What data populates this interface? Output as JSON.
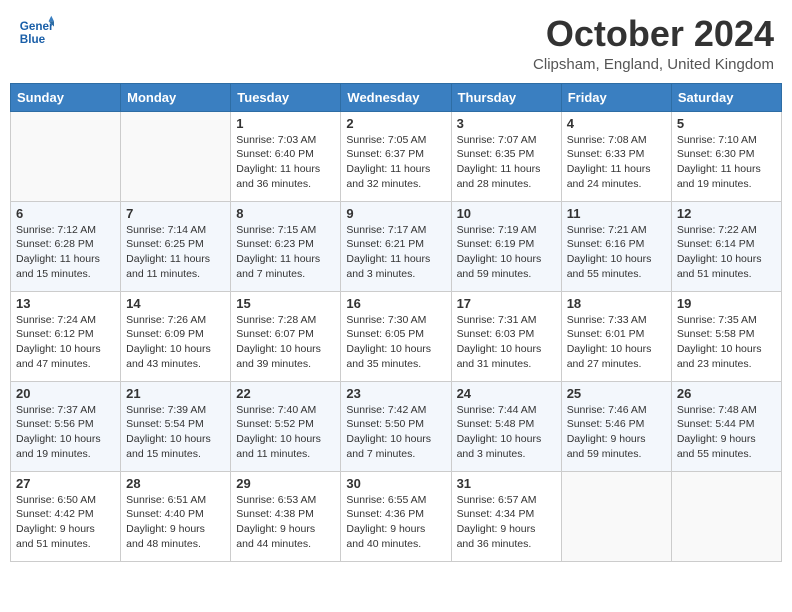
{
  "header": {
    "logo_line1": "General",
    "logo_line2": "Blue",
    "month_title": "October 2024",
    "location": "Clipsham, England, United Kingdom"
  },
  "days_of_week": [
    "Sunday",
    "Monday",
    "Tuesday",
    "Wednesday",
    "Thursday",
    "Friday",
    "Saturday"
  ],
  "weeks": [
    [
      {
        "day": "",
        "info": ""
      },
      {
        "day": "",
        "info": ""
      },
      {
        "day": "1",
        "info": "Sunrise: 7:03 AM\nSunset: 6:40 PM\nDaylight: 11 hours and 36 minutes."
      },
      {
        "day": "2",
        "info": "Sunrise: 7:05 AM\nSunset: 6:37 PM\nDaylight: 11 hours and 32 minutes."
      },
      {
        "day": "3",
        "info": "Sunrise: 7:07 AM\nSunset: 6:35 PM\nDaylight: 11 hours and 28 minutes."
      },
      {
        "day": "4",
        "info": "Sunrise: 7:08 AM\nSunset: 6:33 PM\nDaylight: 11 hours and 24 minutes."
      },
      {
        "day": "5",
        "info": "Sunrise: 7:10 AM\nSunset: 6:30 PM\nDaylight: 11 hours and 19 minutes."
      }
    ],
    [
      {
        "day": "6",
        "info": "Sunrise: 7:12 AM\nSunset: 6:28 PM\nDaylight: 11 hours and 15 minutes."
      },
      {
        "day": "7",
        "info": "Sunrise: 7:14 AM\nSunset: 6:25 PM\nDaylight: 11 hours and 11 minutes."
      },
      {
        "day": "8",
        "info": "Sunrise: 7:15 AM\nSunset: 6:23 PM\nDaylight: 11 hours and 7 minutes."
      },
      {
        "day": "9",
        "info": "Sunrise: 7:17 AM\nSunset: 6:21 PM\nDaylight: 11 hours and 3 minutes."
      },
      {
        "day": "10",
        "info": "Sunrise: 7:19 AM\nSunset: 6:19 PM\nDaylight: 10 hours and 59 minutes."
      },
      {
        "day": "11",
        "info": "Sunrise: 7:21 AM\nSunset: 6:16 PM\nDaylight: 10 hours and 55 minutes."
      },
      {
        "day": "12",
        "info": "Sunrise: 7:22 AM\nSunset: 6:14 PM\nDaylight: 10 hours and 51 minutes."
      }
    ],
    [
      {
        "day": "13",
        "info": "Sunrise: 7:24 AM\nSunset: 6:12 PM\nDaylight: 10 hours and 47 minutes."
      },
      {
        "day": "14",
        "info": "Sunrise: 7:26 AM\nSunset: 6:09 PM\nDaylight: 10 hours and 43 minutes."
      },
      {
        "day": "15",
        "info": "Sunrise: 7:28 AM\nSunset: 6:07 PM\nDaylight: 10 hours and 39 minutes."
      },
      {
        "day": "16",
        "info": "Sunrise: 7:30 AM\nSunset: 6:05 PM\nDaylight: 10 hours and 35 minutes."
      },
      {
        "day": "17",
        "info": "Sunrise: 7:31 AM\nSunset: 6:03 PM\nDaylight: 10 hours and 31 minutes."
      },
      {
        "day": "18",
        "info": "Sunrise: 7:33 AM\nSunset: 6:01 PM\nDaylight: 10 hours and 27 minutes."
      },
      {
        "day": "19",
        "info": "Sunrise: 7:35 AM\nSunset: 5:58 PM\nDaylight: 10 hours and 23 minutes."
      }
    ],
    [
      {
        "day": "20",
        "info": "Sunrise: 7:37 AM\nSunset: 5:56 PM\nDaylight: 10 hours and 19 minutes."
      },
      {
        "day": "21",
        "info": "Sunrise: 7:39 AM\nSunset: 5:54 PM\nDaylight: 10 hours and 15 minutes."
      },
      {
        "day": "22",
        "info": "Sunrise: 7:40 AM\nSunset: 5:52 PM\nDaylight: 10 hours and 11 minutes."
      },
      {
        "day": "23",
        "info": "Sunrise: 7:42 AM\nSunset: 5:50 PM\nDaylight: 10 hours and 7 minutes."
      },
      {
        "day": "24",
        "info": "Sunrise: 7:44 AM\nSunset: 5:48 PM\nDaylight: 10 hours and 3 minutes."
      },
      {
        "day": "25",
        "info": "Sunrise: 7:46 AM\nSunset: 5:46 PM\nDaylight: 9 hours and 59 minutes."
      },
      {
        "day": "26",
        "info": "Sunrise: 7:48 AM\nSunset: 5:44 PM\nDaylight: 9 hours and 55 minutes."
      }
    ],
    [
      {
        "day": "27",
        "info": "Sunrise: 6:50 AM\nSunset: 4:42 PM\nDaylight: 9 hours and 51 minutes."
      },
      {
        "day": "28",
        "info": "Sunrise: 6:51 AM\nSunset: 4:40 PM\nDaylight: 9 hours and 48 minutes."
      },
      {
        "day": "29",
        "info": "Sunrise: 6:53 AM\nSunset: 4:38 PM\nDaylight: 9 hours and 44 minutes."
      },
      {
        "day": "30",
        "info": "Sunrise: 6:55 AM\nSunset: 4:36 PM\nDaylight: 9 hours and 40 minutes."
      },
      {
        "day": "31",
        "info": "Sunrise: 6:57 AM\nSunset: 4:34 PM\nDaylight: 9 hours and 36 minutes."
      },
      {
        "day": "",
        "info": ""
      },
      {
        "day": "",
        "info": ""
      }
    ]
  ]
}
